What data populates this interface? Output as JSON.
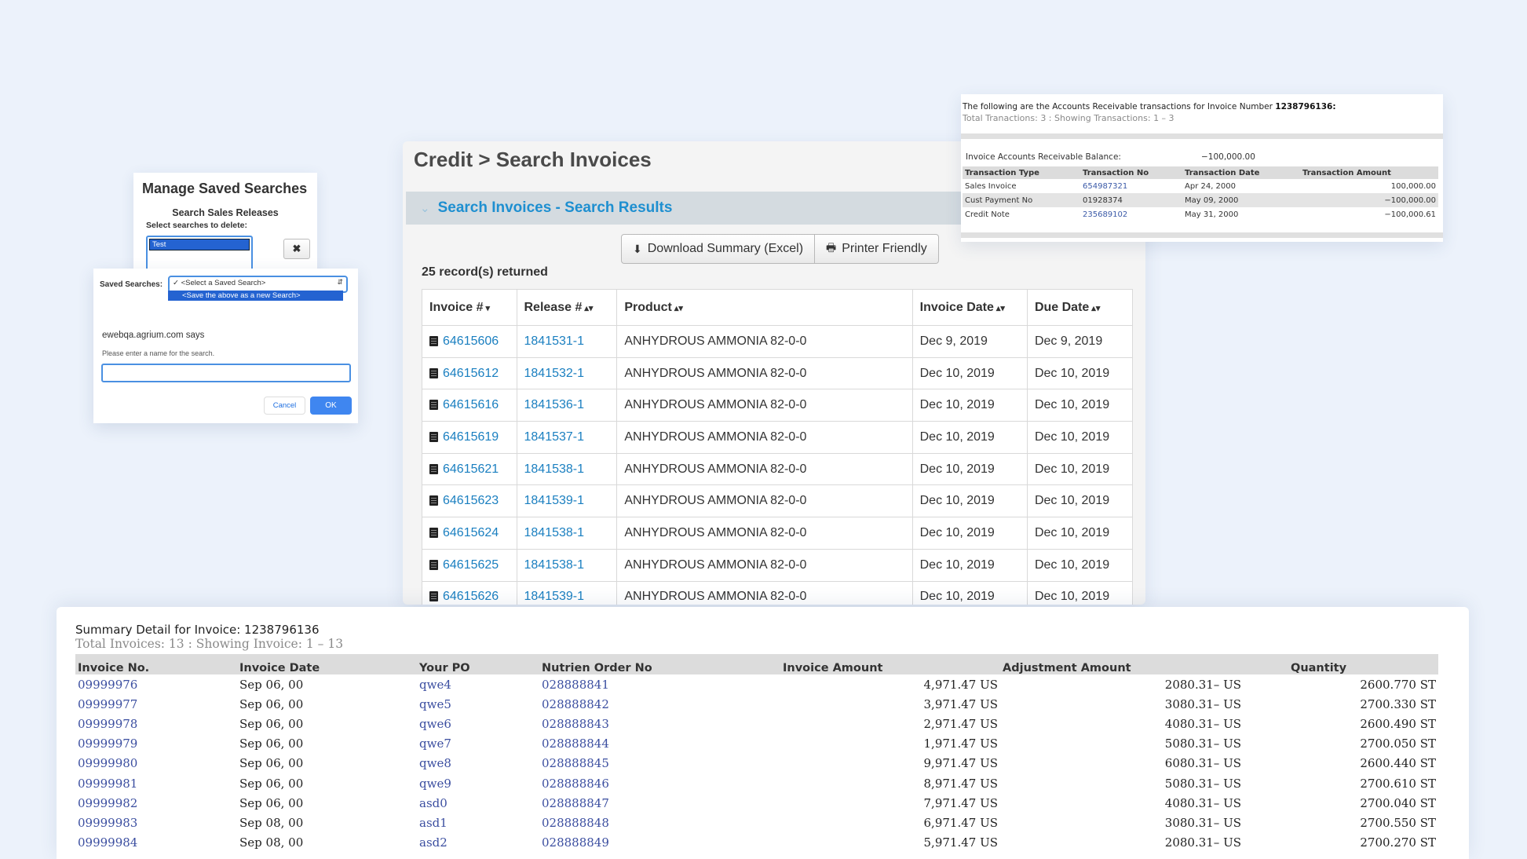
{
  "search_invoices": {
    "page_title": "Credit > Search Invoices",
    "results_title": "Search Invoices - Search Results",
    "download_label": "Download Summary (Excel)",
    "printer_label": "Printer Friendly",
    "records_text": "25 record(s) returned",
    "columns": [
      "Invoice #",
      "Release #",
      "Product",
      "Invoice Date",
      "Due Date"
    ],
    "column_sort_icons": [
      "▾",
      "▴▾",
      "▴▾",
      "▴▾",
      "▴▾"
    ],
    "rows": [
      {
        "invoice": "64615606",
        "release": "1841531-1",
        "product": "ANHYDROUS AMMONIA 82-0-0",
        "invoice_date": "Dec 9, 2019",
        "due_date": "Dec 9, 2019"
      },
      {
        "invoice": "64615612",
        "release": "1841532-1",
        "product": "ANHYDROUS AMMONIA 82-0-0",
        "invoice_date": "Dec 10, 2019",
        "due_date": "Dec 10, 2019"
      },
      {
        "invoice": "64615616",
        "release": "1841536-1",
        "product": "ANHYDROUS AMMONIA 82-0-0",
        "invoice_date": "Dec 10, 2019",
        "due_date": "Dec 10, 2019"
      },
      {
        "invoice": "64615619",
        "release": "1841537-1",
        "product": "ANHYDROUS AMMONIA 82-0-0",
        "invoice_date": "Dec 10, 2019",
        "due_date": "Dec 10, 2019"
      },
      {
        "invoice": "64615621",
        "release": "1841538-1",
        "product": "ANHYDROUS AMMONIA 82-0-0",
        "invoice_date": "Dec 10, 2019",
        "due_date": "Dec 10, 2019"
      },
      {
        "invoice": "64615623",
        "release": "1841539-1",
        "product": "ANHYDROUS AMMONIA 82-0-0",
        "invoice_date": "Dec 10, 2019",
        "due_date": "Dec 10, 2019"
      },
      {
        "invoice": "64615624",
        "release": "1841538-1",
        "product": "ANHYDROUS AMMONIA 82-0-0",
        "invoice_date": "Dec 10, 2019",
        "due_date": "Dec 10, 2019"
      },
      {
        "invoice": "64615625",
        "release": "1841538-1",
        "product": "ANHYDROUS AMMONIA 82-0-0",
        "invoice_date": "Dec 10, 2019",
        "due_date": "Dec 10, 2019"
      },
      {
        "invoice": "64615626",
        "release": "1841539-1",
        "product": "ANHYDROUS AMMONIA 82-0-0",
        "invoice_date": "Dec 10, 2019",
        "due_date": "Dec 10, 2019"
      }
    ]
  },
  "manage_saved": {
    "title": "Manage Saved Searches",
    "subtitle": "Search Sales Releases",
    "select_label": "Select searches to delete:",
    "list_items": [
      "Test"
    ],
    "delete_icon": "✖"
  },
  "dialog": {
    "saved_label": "Saved Searches:",
    "selected_option": "✓ <Select a Saved Search>",
    "highlighted_option": "<Save the above as a new Search>",
    "says": "ewebqa.agrium.com says",
    "prompt": "Please enter a name for the search.",
    "input_value": "",
    "cancel_label": "Cancel",
    "ok_label": "OK"
  },
  "ar_transactions": {
    "intro": "The following are the Accounts Receivable transactions for Invoice Number ",
    "invoice_number": "1238796136:",
    "sub": "Total Tranactions: 3 : Showing Transactions: 1 – 3",
    "balance_label": "Invoice Accounts Receivable Balance:",
    "balance_value": "−100,000.00",
    "columns": [
      "Transaction Type",
      "Transaction No",
      "Transaction Date",
      "Transaction Amount"
    ],
    "rows": [
      {
        "type": "Sales Invoice",
        "no": "654987321",
        "link": true,
        "date": "Apr 24, 2000",
        "amount": "100,000.00"
      },
      {
        "type": "Cust Payment No",
        "no": "01928374",
        "link": false,
        "date": "May 09, 2000",
        "amount": "−100,000.00"
      },
      {
        "type": "Credit Note",
        "no": "235689102",
        "link": true,
        "date": "May 31, 2000",
        "amount": "−100,000.61"
      }
    ]
  },
  "summary_detail": {
    "title": "Summary Detail for Invoice: 1238796136",
    "sub": "Total Invoices: 13 : Showing Invoice: 1 – 13",
    "columns": [
      "Invoice No.",
      "Invoice Date",
      "Your PO",
      "Nutrien Order No",
      "Invoice Amount",
      "Adjustment Amount",
      "Quantity"
    ],
    "rows": [
      {
        "invoice_no": "09999976",
        "date": "Sep 06, 00",
        "po": "qwe4",
        "order_no": "028888841",
        "amount": "4,971.47 US",
        "adjustment": "2080.31– US",
        "quantity": "2600.770 ST"
      },
      {
        "invoice_no": "09999977",
        "date": "Sep 06, 00",
        "po": "qwe5",
        "order_no": "028888842",
        "amount": "3,971.47 US",
        "adjustment": "3080.31– US",
        "quantity": "2700.330 ST"
      },
      {
        "invoice_no": "09999978",
        "date": "Sep 06, 00",
        "po": "qwe6",
        "order_no": "028888843",
        "amount": "2,971.47 US",
        "adjustment": "4080.31– US",
        "quantity": "2600.490 ST"
      },
      {
        "invoice_no": "09999979",
        "date": "Sep 06, 00",
        "po": "qwe7",
        "order_no": "028888844",
        "amount": "1,971.47 US",
        "adjustment": "5080.31– US",
        "quantity": "2700.050 ST"
      },
      {
        "invoice_no": "09999980",
        "date": "Sep 06, 00",
        "po": "qwe8",
        "order_no": "028888845",
        "amount": "9,971.47 US",
        "adjustment": "6080.31– US",
        "quantity": "2600.440 ST"
      },
      {
        "invoice_no": "09999981",
        "date": "Sep 06, 00",
        "po": "qwe9",
        "order_no": "028888846",
        "amount": "8,971.47 US",
        "adjustment": "5080.31– US",
        "quantity": "2700.610 ST"
      },
      {
        "invoice_no": "09999982",
        "date": "Sep 06, 00",
        "po": "asd0",
        "order_no": "028888847",
        "amount": "7,971.47 US",
        "adjustment": "4080.31– US",
        "quantity": "2700.040 ST"
      },
      {
        "invoice_no": "09999983",
        "date": "Sep 08, 00",
        "po": "asd1",
        "order_no": "028888848",
        "amount": "6,971.47 US",
        "adjustment": "3080.31– US",
        "quantity": "2700.550 ST"
      },
      {
        "invoice_no": "09999984",
        "date": "Sep 08, 00",
        "po": "asd2",
        "order_no": "028888849",
        "amount": "5,971.47 US",
        "adjustment": "2080.31– US",
        "quantity": "2700.270 ST"
      }
    ]
  },
  "colors": {
    "background": "#ecf2fb",
    "link": "#1a7fc0",
    "results_bar": "#d4dbe0",
    "accent_blue": "#3f86f0"
  },
  "icons": {
    "download": "download-icon",
    "printer": "printer-icon",
    "invoice_doc": "document-icon",
    "collapse": "chevron-down-icon"
  }
}
